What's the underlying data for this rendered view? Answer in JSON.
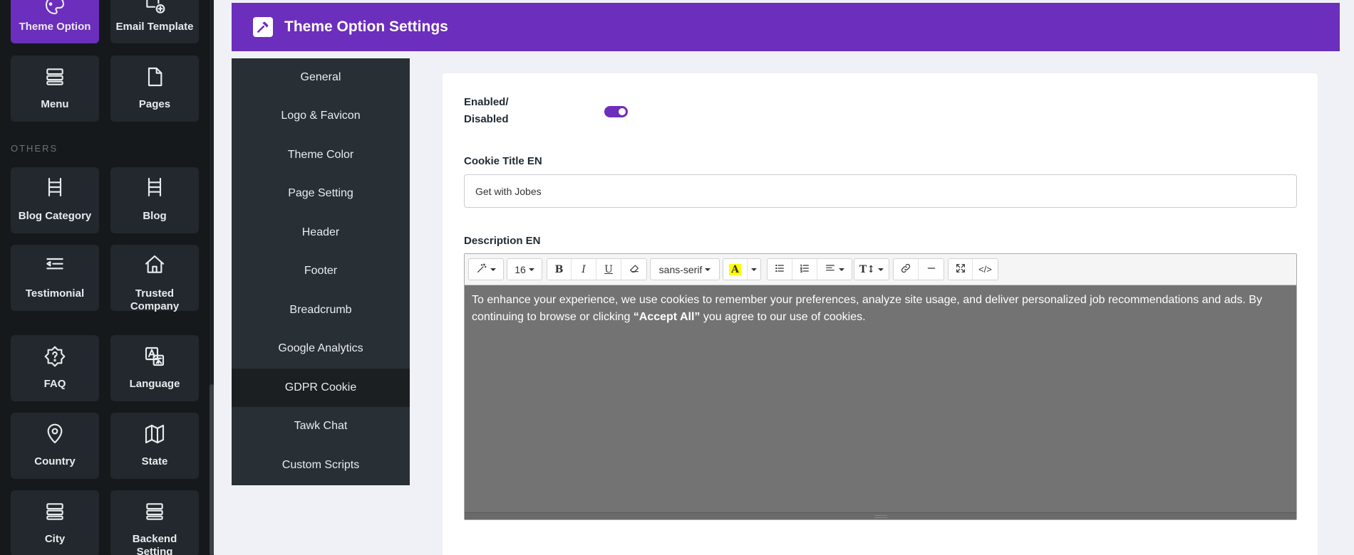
{
  "sidebar": {
    "section_label": "OTHERS",
    "tiles": [
      {
        "label": "Theme Option",
        "icon": "palette-icon"
      },
      {
        "label": "Email Template",
        "icon": "email-template-icon"
      },
      {
        "label": "Menu",
        "icon": "menu-icon"
      },
      {
        "label": "Pages",
        "icon": "page-icon"
      },
      {
        "label": "Blog Category",
        "icon": "blog-category-icon"
      },
      {
        "label": "Blog",
        "icon": "blog-icon"
      },
      {
        "label": "Testimonial",
        "icon": "testimonial-icon"
      },
      {
        "label": "Trusted Company",
        "icon": "home-icon"
      },
      {
        "label": "FAQ",
        "icon": "faq-icon"
      },
      {
        "label": "Language",
        "icon": "language-icon"
      },
      {
        "label": "Country",
        "icon": "map-pin-icon"
      },
      {
        "label": "State",
        "icon": "map-icon"
      },
      {
        "label": "City",
        "icon": "city-icon"
      },
      {
        "label": "Backend Setting",
        "icon": "server-icon"
      }
    ]
  },
  "header": {
    "title": "Theme Option Settings",
    "icon": "hammer-icon",
    "color": "#6c2ebc"
  },
  "settings_menu": {
    "items": [
      "General",
      "Logo & Favicon",
      "Theme Color",
      "Page Setting",
      "Header",
      "Footer",
      "Breadcrumb",
      "Google Analytics",
      "GDPR Cookie",
      "Tawk Chat",
      "Custom Scripts"
    ],
    "active": "GDPR Cookie"
  },
  "form": {
    "enabled_label": "Enabled/ Disabled",
    "enabled": true,
    "cookie_title_label": "Cookie Title EN",
    "cookie_title_value": "Get with Jobes",
    "description_label": "Description EN",
    "editor": {
      "font_size": "16",
      "font_family": "sans-serif",
      "text_before": "To enhance your experience, we use cookies to remember your preferences, analyze site usage, and deliver personalized job recommendations and ads. By continuing to browse or clicking ",
      "text_bold": "“Accept All”",
      "text_after": " you agree to our use of cookies."
    }
  }
}
